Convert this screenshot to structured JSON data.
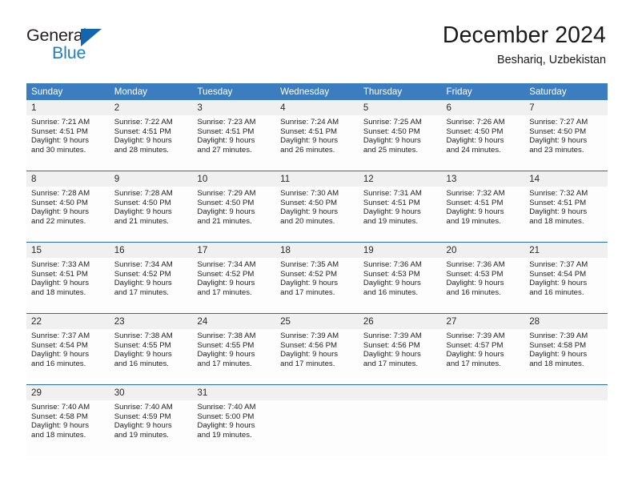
{
  "brand": {
    "name_part1": "General",
    "name_part2": "Blue",
    "triangle_icon": "triangle-logo-icon",
    "accent_color": "#1f7ec4",
    "dark_color": "#231f20"
  },
  "header": {
    "title": "December 2024",
    "location": "Beshariq, Uzbekistan"
  },
  "calendar": {
    "header_bg": "#3b7dbf",
    "week_border": "#2b6ca8",
    "daynum_bg": "#f0f0f0",
    "weekday_names": [
      "Sunday",
      "Monday",
      "Tuesday",
      "Wednesday",
      "Thursday",
      "Friday",
      "Saturday"
    ],
    "labels": {
      "sunrise": "Sunrise:",
      "sunset": "Sunset:",
      "daylight": "Daylight:"
    },
    "weeks": [
      [
        {
          "day": "1",
          "sunrise": "Sunrise: 7:21 AM",
          "sunset": "Sunset: 4:51 PM",
          "daylight_line1": "Daylight: 9 hours",
          "daylight_line2": "and 30 minutes."
        },
        {
          "day": "2",
          "sunrise": "Sunrise: 7:22 AM",
          "sunset": "Sunset: 4:51 PM",
          "daylight_line1": "Daylight: 9 hours",
          "daylight_line2": "and 28 minutes."
        },
        {
          "day": "3",
          "sunrise": "Sunrise: 7:23 AM",
          "sunset": "Sunset: 4:51 PM",
          "daylight_line1": "Daylight: 9 hours",
          "daylight_line2": "and 27 minutes."
        },
        {
          "day": "4",
          "sunrise": "Sunrise: 7:24 AM",
          "sunset": "Sunset: 4:51 PM",
          "daylight_line1": "Daylight: 9 hours",
          "daylight_line2": "and 26 minutes."
        },
        {
          "day": "5",
          "sunrise": "Sunrise: 7:25 AM",
          "sunset": "Sunset: 4:50 PM",
          "daylight_line1": "Daylight: 9 hours",
          "daylight_line2": "and 25 minutes."
        },
        {
          "day": "6",
          "sunrise": "Sunrise: 7:26 AM",
          "sunset": "Sunset: 4:50 PM",
          "daylight_line1": "Daylight: 9 hours",
          "daylight_line2": "and 24 minutes."
        },
        {
          "day": "7",
          "sunrise": "Sunrise: 7:27 AM",
          "sunset": "Sunset: 4:50 PM",
          "daylight_line1": "Daylight: 9 hours",
          "daylight_line2": "and 23 minutes."
        }
      ],
      [
        {
          "day": "8",
          "sunrise": "Sunrise: 7:28 AM",
          "sunset": "Sunset: 4:50 PM",
          "daylight_line1": "Daylight: 9 hours",
          "daylight_line2": "and 22 minutes."
        },
        {
          "day": "9",
          "sunrise": "Sunrise: 7:28 AM",
          "sunset": "Sunset: 4:50 PM",
          "daylight_line1": "Daylight: 9 hours",
          "daylight_line2": "and 21 minutes."
        },
        {
          "day": "10",
          "sunrise": "Sunrise: 7:29 AM",
          "sunset": "Sunset: 4:50 PM",
          "daylight_line1": "Daylight: 9 hours",
          "daylight_line2": "and 21 minutes."
        },
        {
          "day": "11",
          "sunrise": "Sunrise: 7:30 AM",
          "sunset": "Sunset: 4:50 PM",
          "daylight_line1": "Daylight: 9 hours",
          "daylight_line2": "and 20 minutes."
        },
        {
          "day": "12",
          "sunrise": "Sunrise: 7:31 AM",
          "sunset": "Sunset: 4:51 PM",
          "daylight_line1": "Daylight: 9 hours",
          "daylight_line2": "and 19 minutes."
        },
        {
          "day": "13",
          "sunrise": "Sunrise: 7:32 AM",
          "sunset": "Sunset: 4:51 PM",
          "daylight_line1": "Daylight: 9 hours",
          "daylight_line2": "and 19 minutes."
        },
        {
          "day": "14",
          "sunrise": "Sunrise: 7:32 AM",
          "sunset": "Sunset: 4:51 PM",
          "daylight_line1": "Daylight: 9 hours",
          "daylight_line2": "and 18 minutes."
        }
      ],
      [
        {
          "day": "15",
          "sunrise": "Sunrise: 7:33 AM",
          "sunset": "Sunset: 4:51 PM",
          "daylight_line1": "Daylight: 9 hours",
          "daylight_line2": "and 18 minutes."
        },
        {
          "day": "16",
          "sunrise": "Sunrise: 7:34 AM",
          "sunset": "Sunset: 4:52 PM",
          "daylight_line1": "Daylight: 9 hours",
          "daylight_line2": "and 17 minutes."
        },
        {
          "day": "17",
          "sunrise": "Sunrise: 7:34 AM",
          "sunset": "Sunset: 4:52 PM",
          "daylight_line1": "Daylight: 9 hours",
          "daylight_line2": "and 17 minutes."
        },
        {
          "day": "18",
          "sunrise": "Sunrise: 7:35 AM",
          "sunset": "Sunset: 4:52 PM",
          "daylight_line1": "Daylight: 9 hours",
          "daylight_line2": "and 17 minutes."
        },
        {
          "day": "19",
          "sunrise": "Sunrise: 7:36 AM",
          "sunset": "Sunset: 4:53 PM",
          "daylight_line1": "Daylight: 9 hours",
          "daylight_line2": "and 16 minutes."
        },
        {
          "day": "20",
          "sunrise": "Sunrise: 7:36 AM",
          "sunset": "Sunset: 4:53 PM",
          "daylight_line1": "Daylight: 9 hours",
          "daylight_line2": "and 16 minutes."
        },
        {
          "day": "21",
          "sunrise": "Sunrise: 7:37 AM",
          "sunset": "Sunset: 4:54 PM",
          "daylight_line1": "Daylight: 9 hours",
          "daylight_line2": "and 16 minutes."
        }
      ],
      [
        {
          "day": "22",
          "sunrise": "Sunrise: 7:37 AM",
          "sunset": "Sunset: 4:54 PM",
          "daylight_line1": "Daylight: 9 hours",
          "daylight_line2": "and 16 minutes."
        },
        {
          "day": "23",
          "sunrise": "Sunrise: 7:38 AM",
          "sunset": "Sunset: 4:55 PM",
          "daylight_line1": "Daylight: 9 hours",
          "daylight_line2": "and 16 minutes."
        },
        {
          "day": "24",
          "sunrise": "Sunrise: 7:38 AM",
          "sunset": "Sunset: 4:55 PM",
          "daylight_line1": "Daylight: 9 hours",
          "daylight_line2": "and 17 minutes."
        },
        {
          "day": "25",
          "sunrise": "Sunrise: 7:39 AM",
          "sunset": "Sunset: 4:56 PM",
          "daylight_line1": "Daylight: 9 hours",
          "daylight_line2": "and 17 minutes."
        },
        {
          "day": "26",
          "sunrise": "Sunrise: 7:39 AM",
          "sunset": "Sunset: 4:56 PM",
          "daylight_line1": "Daylight: 9 hours",
          "daylight_line2": "and 17 minutes."
        },
        {
          "day": "27",
          "sunrise": "Sunrise: 7:39 AM",
          "sunset": "Sunset: 4:57 PM",
          "daylight_line1": "Daylight: 9 hours",
          "daylight_line2": "and 17 minutes."
        },
        {
          "day": "28",
          "sunrise": "Sunrise: 7:39 AM",
          "sunset": "Sunset: 4:58 PM",
          "daylight_line1": "Daylight: 9 hours",
          "daylight_line2": "and 18 minutes."
        }
      ],
      [
        {
          "day": "29",
          "sunrise": "Sunrise: 7:40 AM",
          "sunset": "Sunset: 4:58 PM",
          "daylight_line1": "Daylight: 9 hours",
          "daylight_line2": "and 18 minutes."
        },
        {
          "day": "30",
          "sunrise": "Sunrise: 7:40 AM",
          "sunset": "Sunset: 4:59 PM",
          "daylight_line1": "Daylight: 9 hours",
          "daylight_line2": "and 19 minutes."
        },
        {
          "day": "31",
          "sunrise": "Sunrise: 7:40 AM",
          "sunset": "Sunset: 5:00 PM",
          "daylight_line1": "Daylight: 9 hours",
          "daylight_line2": "and 19 minutes."
        },
        {
          "day": "",
          "sunrise": "",
          "sunset": "",
          "daylight_line1": "",
          "daylight_line2": ""
        },
        {
          "day": "",
          "sunrise": "",
          "sunset": "",
          "daylight_line1": "",
          "daylight_line2": ""
        },
        {
          "day": "",
          "sunrise": "",
          "sunset": "",
          "daylight_line1": "",
          "daylight_line2": ""
        },
        {
          "day": "",
          "sunrise": "",
          "sunset": "",
          "daylight_line1": "",
          "daylight_line2": ""
        }
      ]
    ]
  }
}
